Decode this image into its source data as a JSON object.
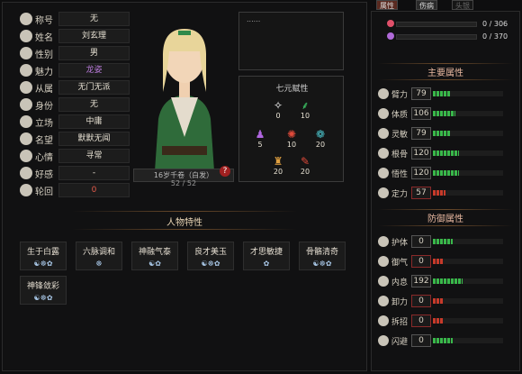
{
  "info": [
    {
      "label": "称号",
      "value": "无",
      "cls": ""
    },
    {
      "label": "姓名",
      "value": "刘玄理",
      "cls": ""
    },
    {
      "label": "性别",
      "value": "男",
      "cls": ""
    },
    {
      "label": "魅力",
      "value": "龙姿",
      "cls": "purple"
    },
    {
      "label": "从属",
      "value": "无门无派",
      "cls": ""
    },
    {
      "label": "身份",
      "value": "无",
      "cls": ""
    },
    {
      "label": "立场",
      "value": "中庸",
      "cls": ""
    },
    {
      "label": "名望",
      "value": "默默无闻",
      "cls": ""
    },
    {
      "label": "心情",
      "value": "寻常",
      "cls": ""
    },
    {
      "label": "好感",
      "value": "-",
      "cls": ""
    },
    {
      "label": "轮回",
      "value": "0",
      "cls": "red"
    }
  ],
  "portrait": {
    "caption": "16岁千卷（白发）",
    "hp": "52 / 52",
    "help": "?"
  },
  "note_box": {
    "text": "......"
  },
  "elements": {
    "title": "七元赋性",
    "items": [
      {
        "glyph": "✧",
        "value": "0",
        "color": "#ffffff"
      },
      {
        "glyph": "⸙",
        "value": "10",
        "color": "#3fd06a"
      },
      {
        "glyph": "♟",
        "value": "5",
        "color": "#b066e0"
      },
      {
        "glyph": "✺",
        "value": "10",
        "color": "#e04a3a"
      },
      {
        "glyph": "❁",
        "value": "20",
        "color": "#4ac0c8"
      },
      {
        "glyph": "♜",
        "value": "20",
        "color": "#e0a040"
      },
      {
        "glyph": "✎",
        "value": "20",
        "color": "#e04a3a"
      }
    ]
  },
  "traits": {
    "title": "人物特性",
    "items": [
      {
        "name": "生于白露",
        "icons": "☯☸✿"
      },
      {
        "name": "六脉调和",
        "icons": "☸"
      },
      {
        "name": "神融气泰",
        "icons": "☯✿"
      },
      {
        "name": "良才美玉",
        "icons": "☯☸✿"
      },
      {
        "name": "才思敏捷",
        "icons": "✿"
      },
      {
        "name": "骨骼清奇",
        "icons": "☯☸✿"
      },
      {
        "name": "神锋敛彩",
        "icons": "☯☸✿"
      }
    ]
  },
  "tabs": {
    "attr": "属性",
    "injury": "伤病",
    "other": "头银"
  },
  "bars": [
    {
      "value": "0 / 306",
      "color": "#e0506a"
    },
    {
      "value": "0 / 370",
      "color": "#b06ad8"
    }
  ],
  "main_attrs": {
    "title": "主要属性",
    "items": [
      {
        "label": "臂力",
        "value": "79",
        "fill": 0.25,
        "red": false
      },
      {
        "label": "体质",
        "value": "106",
        "fill": 0.32,
        "red": false
      },
      {
        "label": "灵敏",
        "value": "79",
        "fill": 0.25,
        "red": false
      },
      {
        "label": "根骨",
        "value": "120",
        "fill": 0.37,
        "red": false
      },
      {
        "label": "悟性",
        "value": "120",
        "fill": 0.37,
        "red": false
      },
      {
        "label": "定力",
        "value": "57",
        "fill": 0.18,
        "red": true
      }
    ]
  },
  "def_attrs": {
    "title": "防御属性",
    "items": [
      {
        "label": "护体",
        "value": "0",
        "fill": 0.28,
        "red": false
      },
      {
        "label": "御气",
        "value": "0",
        "fill": 0.15,
        "red": true
      },
      {
        "label": "内息",
        "value": "192",
        "fill": 0.42,
        "red": false
      },
      {
        "label": "卸力",
        "value": "0",
        "fill": 0.15,
        "red": true
      },
      {
        "label": "拆招",
        "value": "0",
        "fill": 0.15,
        "red": true
      },
      {
        "label": "闪避",
        "value": "0",
        "fill": 0.28,
        "red": false
      }
    ]
  }
}
